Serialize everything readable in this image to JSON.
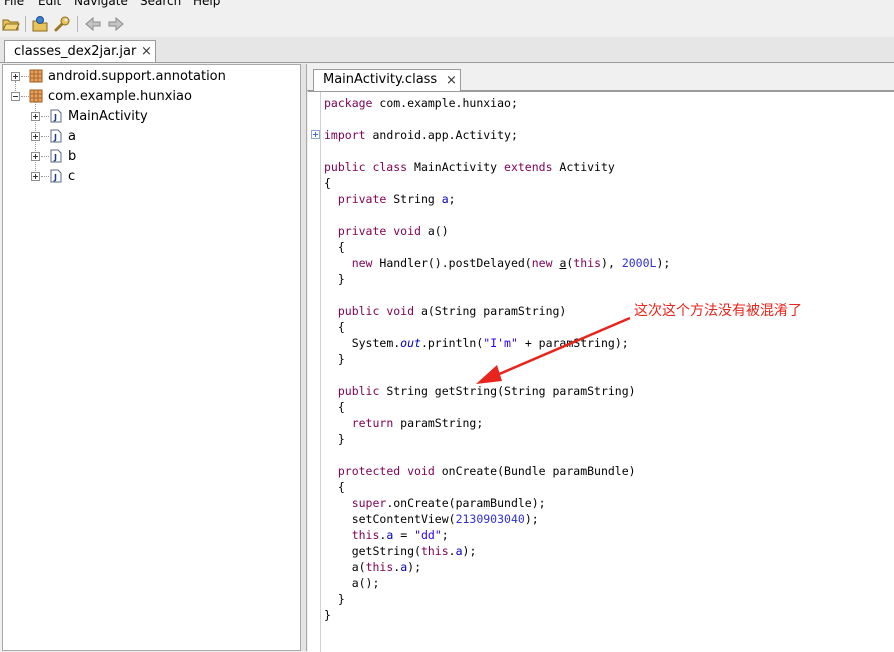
{
  "menu": {
    "file": "File",
    "edit": "Edit",
    "navigate": "Navigate",
    "search": "Search",
    "help": "Help"
  },
  "toolbar": {
    "open_icon": "open-folder-icon",
    "save_icon": "save-sources-icon",
    "settings_icon": "wrench-icon",
    "back_icon": "back-arrow-icon",
    "forward_icon": "forward-arrow-icon"
  },
  "outer_tab": {
    "label": "classes_dex2jar.jar",
    "close": "×"
  },
  "tree": {
    "packages": [
      {
        "label": "android.support.annotation"
      },
      {
        "label": "com.example.hunxiao"
      }
    ],
    "classes": [
      {
        "label": "MainActivity"
      },
      {
        "label": "a"
      },
      {
        "label": "b"
      },
      {
        "label": "c"
      }
    ]
  },
  "editor_tab": {
    "label": "MainActivity.class",
    "close": "×"
  },
  "code": {
    "l1_kw": "package",
    "l1_rest": " com.example.hunxiao;",
    "l2_kw": "import",
    "l2_rest": " android.app.Activity;",
    "l3_kw1": "public class",
    "l3_mid": " MainActivity ",
    "l3_kw2": "extends",
    "l3_rest": " Activity",
    "brace_open": "{",
    "brace_close": "}",
    "l4_kw": "private",
    "l4_mid": " String ",
    "l4_fld": "a",
    "l4_end": ";",
    "l5_kw": "private void",
    "l5_rest": " a()",
    "l6_kw": "new",
    "l6_a": " Handler().postDelayed(",
    "l6_kw2": "new",
    "l6_b": " ",
    "l6_und": "a",
    "l6_c": "(",
    "l6_kw3": "this",
    "l6_d": "), ",
    "l6_num": "2000L",
    "l6_e": ");",
    "l7_kw": "public void",
    "l7_rest": " a(String paramString)",
    "l8_a": "System.",
    "l8_ital": "out",
    "l8_b": ".println(",
    "l8_str": "\"I'm\"",
    "l8_c": " + paramString);",
    "l9_kw": "public",
    "l9_rest": " String getString(String paramString)",
    "l10_kw": "return",
    "l10_rest": " paramString;",
    "l11_kw": "protected void",
    "l11_rest": " onCreate(Bundle paramBundle)",
    "l12_kw": "super",
    "l12_rest": ".onCreate(paramBundle);",
    "l13_a": "setContentView(",
    "l13_num": "2130903040",
    "l13_b": ");",
    "l14_kw": "this",
    "l14_dot": ".",
    "l14_fld": "a",
    "l14_mid": " = ",
    "l14_str": "\"dd\"",
    "l14_end": ";",
    "l15_a": "getString(",
    "l15_kw": "this",
    "l15_dot": ".",
    "l15_fld": "a",
    "l15_end": ");",
    "l16_a": "a(",
    "l16_kw": "this",
    "l16_dot": ".",
    "l16_fld": "a",
    "l16_end": ");",
    "l17": "a();"
  },
  "annotation": {
    "text": "这次这个方法没有被混淆了",
    "color": "#e8241c"
  },
  "colors": {
    "keyword": "#7f0055",
    "field": "#0000c0",
    "string": "#2a00ff",
    "number": "#3030d0"
  }
}
